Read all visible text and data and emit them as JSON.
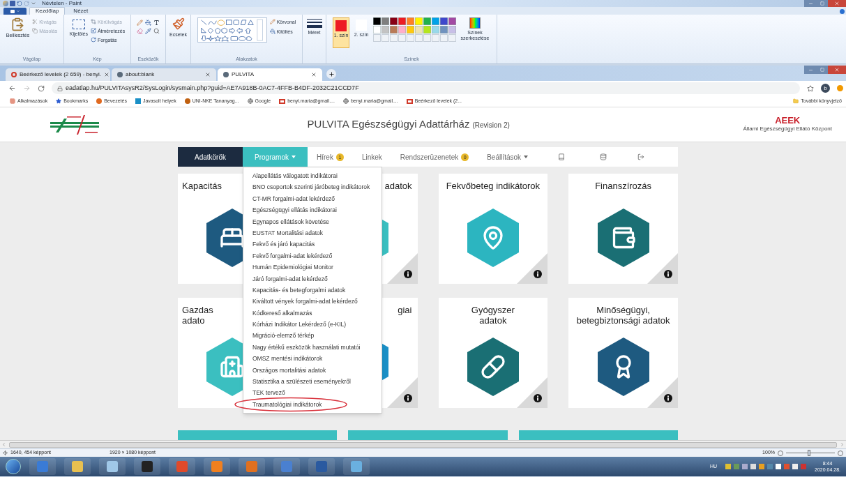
{
  "paint": {
    "title": "Névtelen - Paint",
    "ribbon_tabs": [
      {
        "label": "Kezdőlap",
        "selected": true
      },
      {
        "label": "Nézet",
        "selected": false
      }
    ],
    "clipboard": {
      "label": "Vágólap",
      "paste": "Beillesztés",
      "items": [
        {
          "label": "Kivágás",
          "disabled": true
        },
        {
          "label": "Másolás",
          "disabled": true
        }
      ]
    },
    "image": {
      "label": "Kép",
      "select": "Kijelölés",
      "items": [
        {
          "label": "Körülvágás",
          "disabled": true
        },
        {
          "label": "Átméretezés",
          "disabled": false
        },
        {
          "label": "Forgatás",
          "disabled": false
        }
      ]
    },
    "tools": {
      "label": "Eszközök"
    },
    "brushes": {
      "label": "Ecsetek"
    },
    "shapes": {
      "label": "Alakzatok",
      "outline": "Körvonal",
      "fill": "Kitöltés"
    },
    "size": {
      "label": "Méret"
    },
    "colors": {
      "label": "Színek",
      "slots": [
        {
          "label": "1. szín",
          "selected": true,
          "color": "#ed1c24"
        },
        {
          "label": "2. szín",
          "selected": false,
          "color": "#ffffff"
        }
      ],
      "palette": [
        {
          "color": "#000000"
        },
        {
          "color": "#7f7f7f"
        },
        {
          "color": "#880015"
        },
        {
          "color": "#ed1c24"
        },
        {
          "color": "#ff7f27"
        },
        {
          "color": "#fff200"
        },
        {
          "color": "#22b14c"
        },
        {
          "color": "#00a2e8"
        },
        {
          "color": "#3f48cc"
        },
        {
          "color": "#a349a4"
        },
        {
          "color": "#ffffff"
        },
        {
          "color": "#c3c3c3"
        },
        {
          "color": "#b97a57"
        },
        {
          "color": "#ffaec9"
        },
        {
          "color": "#ffc90e"
        },
        {
          "color": "#efe4b0"
        },
        {
          "color": "#b5e61d"
        },
        {
          "color": "#99d9ea"
        },
        {
          "color": "#7092be"
        },
        {
          "color": "#c8bfe7"
        }
      ],
      "edit": "Színek szerkesztése"
    },
    "status": {
      "cursor": "1640, 454 képpont",
      "canvas_size": "1920 × 1080 képpont",
      "zoom": "100%",
      "zoom_slider": {
        "level": 0.47
      }
    }
  },
  "browser": {
    "tabs": [
      {
        "title": "Beérkező levelek (2 659) - benyi.",
        "selected": false
      },
      {
        "title": "about:blank",
        "selected": false
      },
      {
        "title": "PULVITA",
        "selected": true
      }
    ],
    "url": "eadatlap.hu/PULVITAsysR2/SysLogin/sysmain.php?guid=AE7A918B-0AC7-4FFB-B4DF-2032C21CCD7F",
    "profile": "b",
    "bookmarks": [
      "Alkalmazások",
      "Bookmarks",
      "Bevezetés",
      "Javasolt helyek",
      "UNI-NKE Tananyag...",
      "Google",
      "benyi.maria@gmail....",
      "benyi.maria@gmail....",
      "Beérkező levelek (2..."
    ],
    "more_bookmarks": "További könyvjelző"
  },
  "page": {
    "title": "PULVITA Egészségügyi Adattárház",
    "revision": "(Revision 2)",
    "org_logo": "AEEK",
    "org_name": "Állami Egészségügyi Ellátó Központ",
    "nav": [
      {
        "label": "Adatkörök",
        "kind": "primary",
        "selected": false
      },
      {
        "label": "Programok",
        "kind": "dropdown",
        "selected": true
      },
      {
        "label": "Hírek",
        "kind": "link",
        "selected": false,
        "badge": "1"
      },
      {
        "label": "Linkek",
        "kind": "link",
        "selected": false
      },
      {
        "label": "Rendszerüzenetek",
        "kind": "link",
        "selected": false,
        "badge": "0"
      },
      {
        "label": "Beállítások",
        "kind": "dropdown",
        "selected": false
      }
    ],
    "menu": [
      {
        "label": "Alapellátás válogatott indikátorai",
        "circled": false
      },
      {
        "label": "BNO csoportok szerinti járóbeteg indikátorok",
        "circled": false
      },
      {
        "label": "CT-MR forgalmi-adat lekérdező",
        "circled": false
      },
      {
        "label": "Egészségügyi ellátás indikátorai",
        "circled": false
      },
      {
        "label": "Egynapos ellátások követése",
        "circled": false
      },
      {
        "label": "EUSTAT Mortalitási adatok",
        "circled": false
      },
      {
        "label": "Fekvő és járó kapacitás",
        "circled": false
      },
      {
        "label": "Fekvő forgalmi-adat lekérdező",
        "circled": false
      },
      {
        "label": "Humán Epidemiológiai Monitor",
        "circled": false
      },
      {
        "label": "Járó forgalmi-adat lekérdező",
        "circled": false
      },
      {
        "label": "Kapacitás- és betegforgalmi adatok",
        "circled": false
      },
      {
        "label": "Kiváltott vények forgalmi-adat lekérdező",
        "circled": false
      },
      {
        "label": "Kódkereső alkalmazás",
        "circled": false
      },
      {
        "label": "Kórházi Indikátor Lekérdező (e-KIL)",
        "circled": false
      },
      {
        "label": "Migráció-elemző térkép",
        "circled": false
      },
      {
        "label": "Nagy értékű eszközök használati mutatói",
        "circled": false
      },
      {
        "label": "OMSZ mentési indikátorok",
        "circled": false
      },
      {
        "label": "Országos mortalitási adatok",
        "circled": false
      },
      {
        "label": "Statisztika a szülészeti eseményekről",
        "circled": false
      },
      {
        "label": "TEK tervező",
        "circled": false
      },
      {
        "label": "Traumatológiai indikátorok",
        "circled": true
      }
    ],
    "cards": [
      {
        "title_lines": [
          "Kapacitás"
        ],
        "kind": "cut_right",
        "color": "#1e5a80"
      },
      {
        "title_lines": [
          "adatok"
        ],
        "kind": "cut_left",
        "color": "#3bbfc0"
      },
      {
        "title_lines": [
          "Fekvőbeteg indikátorok"
        ],
        "kind": "full",
        "color": "#2cb5c0"
      },
      {
        "title_lines": [
          "Finanszírozás"
        ],
        "kind": "full",
        "color": "#1a6f74"
      },
      {
        "title_lines": [
          "Gazdas",
          "adato"
        ],
        "kind": "cut_right",
        "color": "#3bbfc0"
      },
      {
        "title_lines": [
          "giai"
        ],
        "kind": "cut_left",
        "color": "#1b8fc6"
      },
      {
        "title_lines": [
          "Gyógyszer",
          "adatok"
        ],
        "kind": "full",
        "color": "#1a6f74"
      },
      {
        "title_lines": [
          "Minőségügyi,",
          "betegbiztonsági adatok"
        ],
        "kind": "full",
        "color": "#1e5a80"
      }
    ]
  },
  "taskbar": {
    "language": "HU",
    "time": "8:44",
    "date": "2020.04.28."
  }
}
